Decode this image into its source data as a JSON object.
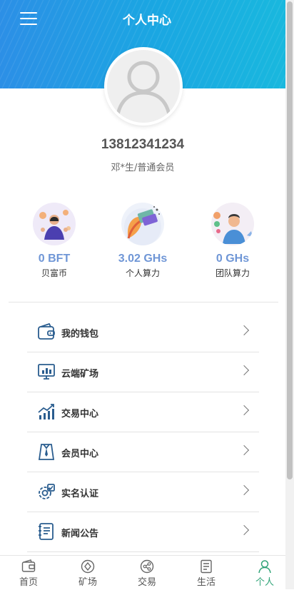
{
  "header": {
    "title": "个人中心",
    "menu_icon": "hamburger-icon"
  },
  "profile": {
    "avatar_icon": "user-avatar-icon",
    "phone": "13812341234",
    "member": "邓*生/普通会员"
  },
  "stats": [
    {
      "value": "0 BFT",
      "label": "贝富币",
      "icon": "coin-person-icon"
    },
    {
      "value": "3.02 GHs",
      "label": "个人算力",
      "icon": "card-hashrate-icon"
    },
    {
      "value": "0 GHs",
      "label": "团队算力",
      "icon": "team-coins-icon"
    }
  ],
  "menu": [
    {
      "label": "我的钱包",
      "icon": "wallet-icon"
    },
    {
      "label": "云端矿场",
      "icon": "cloud-mine-icon"
    },
    {
      "label": "交易中心",
      "icon": "trade-chart-icon"
    },
    {
      "label": "会员中心",
      "icon": "member-tie-icon"
    },
    {
      "label": "实名认证",
      "icon": "verify-gear-icon"
    },
    {
      "label": "新闻公告",
      "icon": "news-book-icon"
    }
  ],
  "tabs": [
    {
      "label": "首页",
      "icon": "home-wallet-icon",
      "active": false
    },
    {
      "label": "矿场",
      "icon": "mine-diamond-icon",
      "active": false
    },
    {
      "label": "交易",
      "icon": "exchange-share-icon",
      "active": false
    },
    {
      "label": "生活",
      "icon": "life-document-icon",
      "active": false
    },
    {
      "label": "个人",
      "icon": "profile-person-icon",
      "active": true
    }
  ],
  "colors": {
    "header_start": "#2c8fe6",
    "header_end": "#19b8de",
    "value_blue": "#6f96d6",
    "active_tab": "#2fa377",
    "icon_blue": "#2a5d8f"
  }
}
